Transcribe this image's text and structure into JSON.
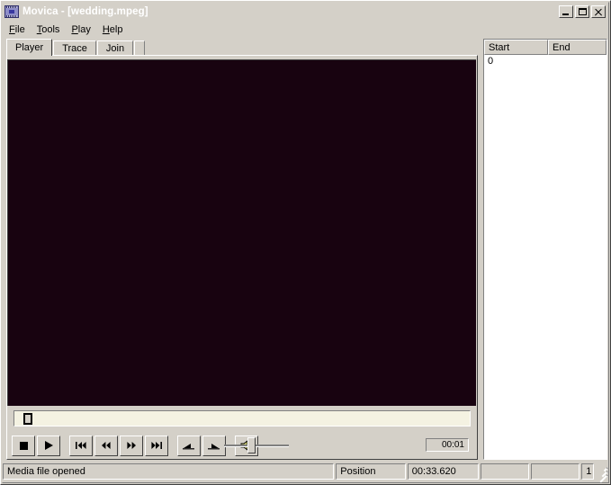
{
  "window": {
    "title": "Movica - [wedding.mpeg]",
    "icon": "film-icon",
    "controls": {
      "minimize": "minimize-icon",
      "maximize": "maximize-icon",
      "close": "close-icon"
    }
  },
  "menu": {
    "items": [
      {
        "label": "File",
        "accel": "F",
        "rest": "ile"
      },
      {
        "label": "Tools",
        "accel": "T",
        "rest": "ools"
      },
      {
        "label": "Play",
        "accel": "P",
        "rest": "lay"
      },
      {
        "label": "Help",
        "accel": "H",
        "rest": "elp"
      }
    ]
  },
  "tabs": {
    "items": [
      {
        "label": "Player",
        "active": true
      },
      {
        "label": "Trace",
        "active": false
      },
      {
        "label": "Join",
        "active": false
      }
    ]
  },
  "player": {
    "video_background": "#180310",
    "seek": {
      "name": "seek-slider",
      "position_percent": 2
    },
    "transport": [
      {
        "name": "stop-button",
        "icon": "stop-icon"
      },
      {
        "name": "play-button",
        "icon": "play-icon"
      },
      {
        "name": "skip-back-button",
        "icon": "skip-back-icon"
      },
      {
        "name": "rewind-button",
        "icon": "rewind-icon"
      },
      {
        "name": "fast-forward-button",
        "icon": "fast-forward-icon"
      },
      {
        "name": "skip-forward-button",
        "icon": "skip-forward-icon"
      },
      {
        "name": "mark-in-button",
        "icon": "mark-in-icon"
      },
      {
        "name": "mark-out-button",
        "icon": "mark-out-icon"
      },
      {
        "name": "volume-button",
        "icon": "speaker-icon"
      }
    ],
    "volume": {
      "name": "volume-slider",
      "value_percent": 38
    },
    "time_readout": "00:01"
  },
  "clip_list": {
    "columns": [
      "Start",
      "End"
    ],
    "rows": [
      {
        "start": "0",
        "end": ""
      }
    ]
  },
  "statusbar": {
    "message": "Media file opened",
    "position_label": "Position",
    "position_value": "00:33.620",
    "blank1": "",
    "blank2": "",
    "count": "1"
  },
  "colors": {
    "face": "#d4d0c8",
    "title_start": "#0a246a",
    "title_end": "#a6caf0",
    "video": "#180310",
    "seek_track": "#f4f2e2"
  }
}
